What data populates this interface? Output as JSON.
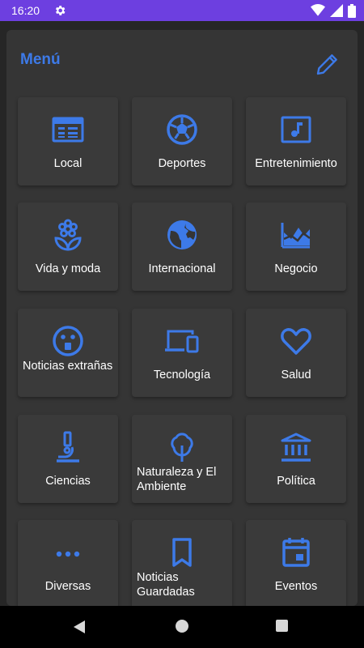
{
  "status_bar": {
    "time": "16:20",
    "icons": [
      "gear-icon",
      "wifi-icon",
      "signal-icon",
      "battery-icon"
    ]
  },
  "header": {
    "title": "Menú",
    "edit_icon": "pencil-icon"
  },
  "accent_color": "#3d7ae8",
  "tiles": [
    {
      "label": "Local",
      "icon": "newspaper-icon"
    },
    {
      "label": "Deportes",
      "icon": "soccer-ball-icon"
    },
    {
      "label": "Entretenimiento",
      "icon": "music-note-icon"
    },
    {
      "label": "Vida y moda",
      "icon": "flower-icon"
    },
    {
      "label": "Internacional",
      "icon": "globe-icon"
    },
    {
      "label": "Negocio",
      "icon": "area-chart-icon"
    },
    {
      "label": "Noticias extrañas",
      "icon": "surprised-face-icon"
    },
    {
      "label": "Tecnología",
      "icon": "devices-icon"
    },
    {
      "label": "Salud",
      "icon": "heart-icon"
    },
    {
      "label": "Ciencias",
      "icon": "microscope-icon"
    },
    {
      "label": "Naturaleza y El Ambiente",
      "icon": "tree-icon"
    },
    {
      "label": "Política",
      "icon": "building-columns-icon"
    },
    {
      "label": "Diversas",
      "icon": "more-dots-icon"
    },
    {
      "label": "Noticias Guardadas",
      "icon": "bookmark-icon"
    },
    {
      "label": "Eventos",
      "icon": "calendar-icon"
    }
  ],
  "nav_bar": {
    "icons": [
      "back-icon",
      "home-icon",
      "recents-icon"
    ]
  }
}
